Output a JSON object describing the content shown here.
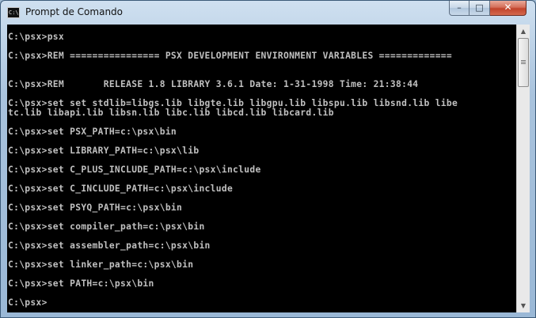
{
  "window": {
    "title": "Prompt de Comando",
    "icon_label": "C:\\",
    "controls": {
      "minimize": "–",
      "maximize": "□",
      "close": "✕"
    }
  },
  "console": {
    "lines": [
      {
        "text": "C:\\psx>psx",
        "row": 0
      },
      {
        "text": "C:\\psx>REM ================ PSX DEVELOPMENT ENVIRONMENT VARIABLES =============",
        "row": 2
      },
      {
        "text": "C:\\psx>REM       RELEASE 1.8 LIBRARY 3.6.1 Date: 1-31-1998 Time: 21:38:44",
        "row": 5
      },
      {
        "text": "C:\\psx>set set stdlib=libgs.lib libgte.lib libgpu.lib libspu.lib libsnd.lib libe",
        "row": 7
      },
      {
        "text": "tc.lib libapi.lib libsn.lib libc.lib libcd.lib libcard.lib",
        "row": 8
      },
      {
        "text": "C:\\psx>set PSX_PATH=c:\\psx\\bin",
        "row": 10
      },
      {
        "text": "C:\\psx>set LIBRARY_PATH=c:\\psx\\lib",
        "row": 12
      },
      {
        "text": "C:\\psx>set C_PLUS_INCLUDE_PATH=c:\\psx\\include",
        "row": 14
      },
      {
        "text": "C:\\psx>set C_INCLUDE_PATH=c:\\psx\\include",
        "row": 16
      },
      {
        "text": "C:\\psx>set PSYQ_PATH=c:\\psx\\bin",
        "row": 18
      },
      {
        "text": "C:\\psx>set compiler_path=c:\\psx\\bin",
        "row": 20
      },
      {
        "text": "C:\\psx>set assembler_path=c:\\psx\\bin",
        "row": 22
      },
      {
        "text": "C:\\psx>set linker_path=c:\\psx\\bin",
        "row": 24
      },
      {
        "text": "C:\\psx>set PATH=c:\\psx\\bin",
        "row": 26
      },
      {
        "text": "C:\\psx>",
        "row": 28
      }
    ]
  },
  "scrollbar": {
    "up_arrow": "▲",
    "down_arrow": "▼"
  }
}
